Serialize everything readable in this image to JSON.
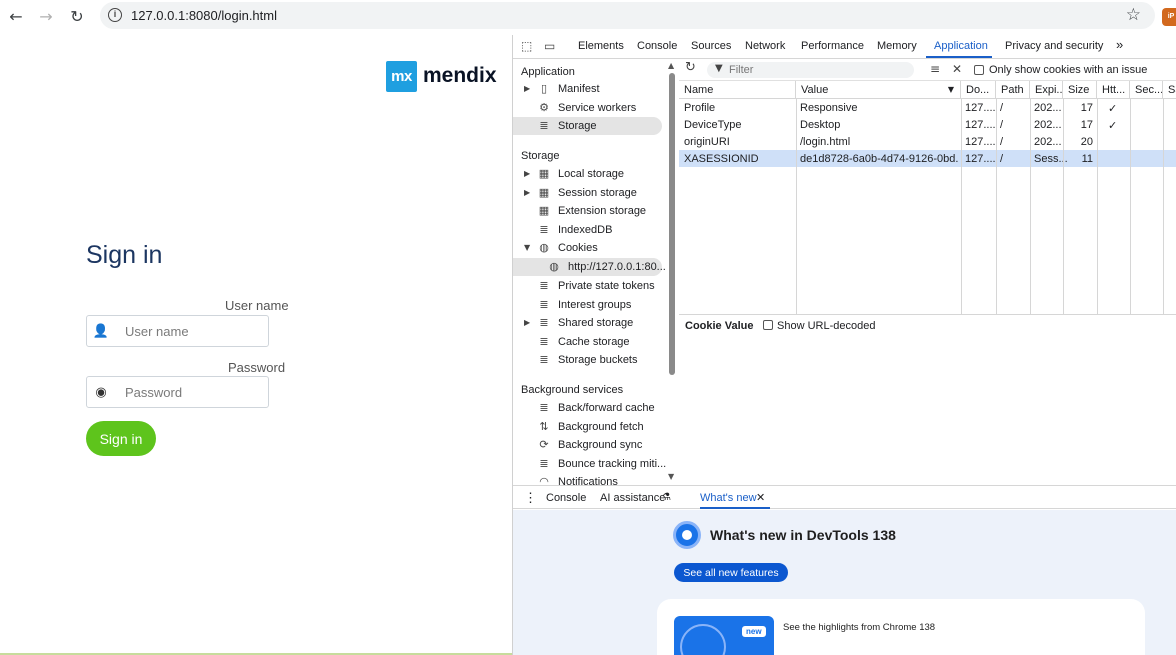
{
  "browser": {
    "url": "127.0.0.1:8080/login.html",
    "back_icon": "back-arrow-icon",
    "forward_icon": "forward-arrow-icon",
    "reload_icon": "reload-icon",
    "star_icon": "bookmark-star-icon"
  },
  "page": {
    "logo_mark": "mx",
    "logo_text": "mendix",
    "title": "Sign in",
    "username_label": "User name",
    "username_placeholder": "User name",
    "password_label": "Password",
    "password_placeholder": "Password",
    "signin_button": "Sign in",
    "accent_color": "#5ec41c",
    "title_color": "#1c3661"
  },
  "devtools": {
    "tabs": [
      "Elements",
      "Console",
      "Sources",
      "Network",
      "Performance",
      "Memory",
      "Application",
      "Privacy and security"
    ],
    "active_tab": "Application",
    "more_tabs": "»",
    "sidebar": {
      "section_application": "Application",
      "application_items": [
        "Manifest",
        "Service workers",
        "Storage"
      ],
      "section_storage": "Storage",
      "storage_items": [
        "Local storage",
        "Session storage",
        "Extension storage",
        "IndexedDB",
        "Cookies",
        "http://127.0.0.1:80...",
        "Private state tokens",
        "Interest groups",
        "Shared storage",
        "Cache storage",
        "Storage buckets"
      ],
      "section_background": "Background services",
      "background_items": [
        "Back/forward cache",
        "Background fetch",
        "Background sync",
        "Bounce tracking miti...",
        "Notifications"
      ]
    },
    "cookies": {
      "filter_placeholder": "Filter",
      "only_issue_label": "Only show cookies with an issue",
      "columns": [
        "Name",
        "Value",
        "Do...",
        "Path",
        "Expi...",
        "Size",
        "Htt...",
        "Sec...",
        "Sa"
      ],
      "rows": [
        {
          "name": "Profile",
          "value": "Responsive",
          "domain": "127....",
          "path": "/",
          "expires": "202...",
          "size": "17",
          "http": "✓"
        },
        {
          "name": "DeviceType",
          "value": "Desktop",
          "domain": "127....",
          "path": "/",
          "expires": "202...",
          "size": "17",
          "http": "✓"
        },
        {
          "name": "originURI",
          "value": "/login.html",
          "domain": "127....",
          "path": "/",
          "expires": "202...",
          "size": "20",
          "http": ""
        },
        {
          "name": "XASESSIONID",
          "value": "de1d8728-6a0b-4d74-9126-0bd...",
          "domain": "127....",
          "path": "/",
          "expires": "Sess...",
          "size": "11",
          "http": ""
        }
      ],
      "selected_row": 3,
      "cookie_value_label": "Cookie Value",
      "show_url_decoded": "Show URL-decoded"
    },
    "drawer": {
      "tabs": [
        "Console",
        "AI assistance",
        "What's new"
      ],
      "active_tab": "What's new",
      "whatsnew_title": "What's new in DevTools 138",
      "see_all_button": "See all new features",
      "card_badge": "new",
      "card_text": "See the highlights from Chrome 138"
    },
    "accent_color": "#1a5fc8"
  }
}
